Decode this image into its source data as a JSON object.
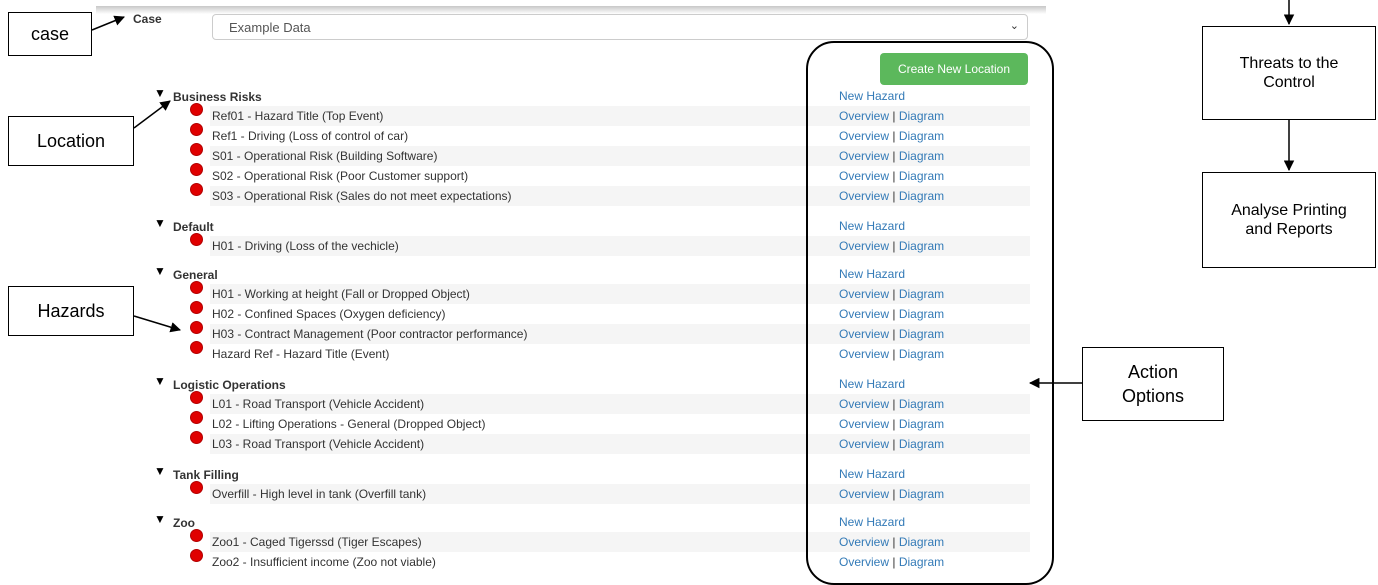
{
  "callouts": {
    "case": "case",
    "location": "Location",
    "hazards": "Hazards",
    "actions_line1": "Action",
    "actions_line2": "Options"
  },
  "case_field": {
    "label": "Case",
    "selected": "Example Data"
  },
  "create_button": "Create New Location",
  "new_hazard_label": "New Hazard",
  "overview_label": "Overview",
  "diagram_label": "Diagram",
  "separator": "|",
  "groups": [
    {
      "name": "Business Risks",
      "hazards": [
        "Ref01 - Hazard Title (Top Event)",
        "Ref1 - Driving (Loss of control of car)",
        "S01 - Operational Risk (Building Software)",
        "S02 - Operational Risk (Poor Customer support)",
        "S03 - Operational Risk (Sales do not meet expectations)"
      ]
    },
    {
      "name": "Default",
      "hazards": [
        "H01 - Driving (Loss of the vechicle)"
      ]
    },
    {
      "name": "General",
      "hazards": [
        "H01 - Working at height (Fall or Dropped Object)",
        "H02 - Confined Spaces (Oxygen deficiency)",
        "H03 - Contract Management (Poor contractor performance)",
        "Hazard Ref - Hazard Title (Event)"
      ]
    },
    {
      "name": "Logistic Operations",
      "hazards": [
        "L01 - Road Transport (Vehicle Accident)",
        "L02 - Lifting Operations - General (Dropped Object)",
        "L03 - Road Transport (Vehicle Accident)"
      ]
    },
    {
      "name": "Tank Filling",
      "hazards": [
        "Overfill - High level in tank (Overfill tank)"
      ]
    },
    {
      "name": "Zoo",
      "hazards": [
        "Zoo1 - Caged Tigerssd (Tiger Escapes)",
        "Zoo2 - Insufficient income (Zoo not viable)"
      ]
    }
  ],
  "flowchart": {
    "threats_line1": "Threats to the",
    "threats_line2": "Control",
    "analyse_line1": "Analyse Printing",
    "analyse_line2": "and Reports"
  }
}
